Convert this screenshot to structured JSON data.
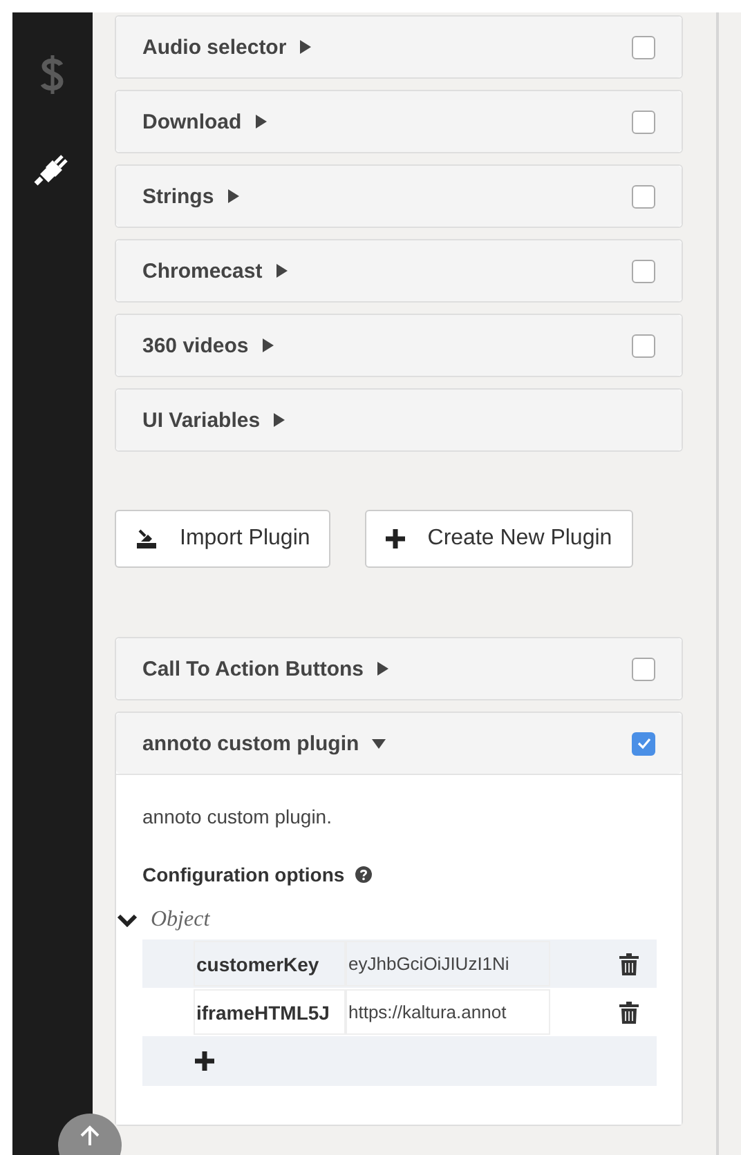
{
  "sidebar": {
    "items": [
      {
        "kind": "dollar",
        "selected": false
      },
      {
        "kind": "plug",
        "selected": true
      }
    ]
  },
  "plugins": [
    {
      "name": "Audio selector",
      "kind": "toggle",
      "expanded": false,
      "checked": false
    },
    {
      "name": "Download",
      "kind": "toggle",
      "expanded": false,
      "checked": false
    },
    {
      "name": "Strings",
      "kind": "toggle",
      "expanded": false,
      "checked": false
    },
    {
      "name": "Chromecast",
      "kind": "toggle",
      "expanded": false,
      "checked": false
    },
    {
      "name": "360 videos",
      "kind": "toggle",
      "expanded": false,
      "checked": false
    },
    {
      "name": "UI Variables",
      "kind": "plain",
      "expanded": false
    }
  ],
  "actions": [
    {
      "label": "Import Plugin",
      "kind": "import"
    },
    {
      "label": "Create New Plugin",
      "kind": "create"
    }
  ],
  "custom_plugins": [
    {
      "name": "Call To Action Buttons",
      "kind": "toggle",
      "expanded": false,
      "checked": false
    },
    {
      "name": "annoto custom plugin",
      "kind": "toggle",
      "expanded": true,
      "checked": true,
      "description": "annoto custom plugin.",
      "config_title": "Configuration options",
      "object_label": "Object",
      "object_expanded": true,
      "properties": [
        {
          "key": "customerKey",
          "value": "eyJhbGciOiJIUzI1Ni"
        },
        {
          "key": "iframeHTML5J",
          "value": "https://kaltura.annot"
        }
      ]
    }
  ]
}
